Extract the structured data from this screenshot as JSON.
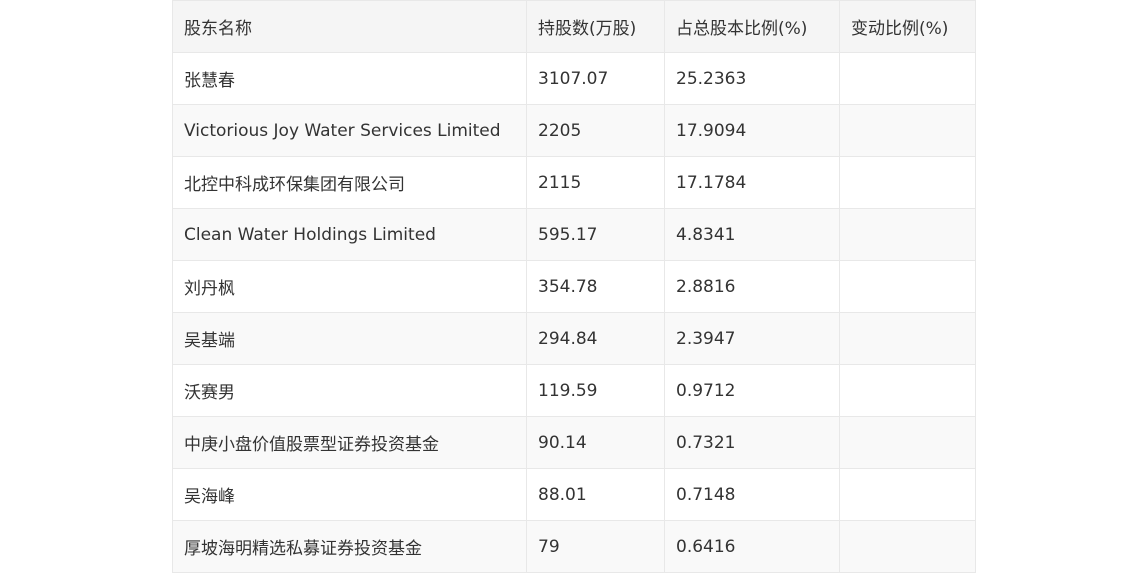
{
  "table": {
    "headers": [
      "股东名称",
      "持股数(万股)",
      "占总股本比例(%)",
      "变动比例(%)"
    ],
    "rows": [
      [
        "张慧春",
        "3107.07",
        "25.2363",
        ""
      ],
      [
        "Victorious Joy Water Services Limited",
        "2205",
        "17.9094",
        ""
      ],
      [
        "北控中科成环保集团有限公司",
        "2115",
        "17.1784",
        ""
      ],
      [
        "Clean Water Holdings Limited",
        "595.17",
        "4.8341",
        ""
      ],
      [
        "刘丹枫",
        "354.78",
        "2.8816",
        ""
      ],
      [
        "吴基端",
        "294.84",
        "2.3947",
        ""
      ],
      [
        "沃赛男",
        "119.59",
        "0.9712",
        ""
      ],
      [
        "中庚小盘价值股票型证券投资基金",
        "90.14",
        "0.7321",
        ""
      ],
      [
        "吴海峰",
        "88.01",
        "0.7148",
        ""
      ],
      [
        "厚坡海明精选私募证券投资基金",
        "79",
        "0.6416",
        ""
      ]
    ]
  }
}
